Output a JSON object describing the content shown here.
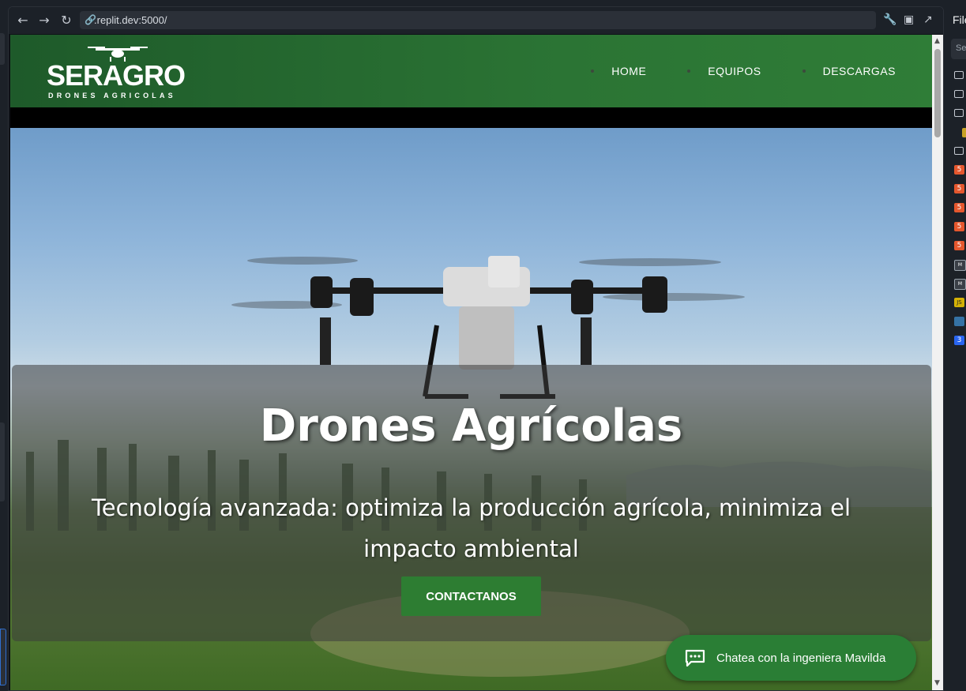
{
  "browser": {
    "url": ".replit.dev:5000/"
  },
  "site": {
    "logo": {
      "name": "SERAGRO",
      "tagline": "DRONES AGRICOLAS"
    },
    "nav": [
      {
        "label": "HOME"
      },
      {
        "label": "EQUIPOS"
      },
      {
        "label": "DESCARGAS"
      }
    ],
    "hero": {
      "title": "Drones Agrícolas",
      "subtitle": "Tecnología avanzada: optimiza la producción agrícola, minimiza el impacto ambiental",
      "cta_label": "CONTACTANOS"
    },
    "chat": {
      "label": "Chatea con la ingeniera Mavilda"
    }
  },
  "files_panel": {
    "title": "Files",
    "search_placeholder": "Se"
  },
  "colors": {
    "header_green": "#2b7434",
    "button_green": "#2d7d32",
    "ide_bg": "#1c2128"
  }
}
